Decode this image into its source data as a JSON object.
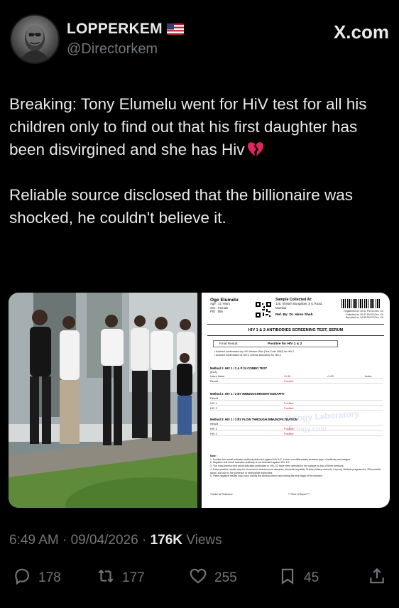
{
  "author": {
    "display_name": "LOPPERKEM",
    "handle": "@Directorkem",
    "flag_icon": "us-flag-icon"
  },
  "brand": "X.com",
  "tweet": {
    "paragraph_1": "Breaking: Tony Elumelu went for HiV test for all his children only to find out that his first daughter has been disvirgined and she has Hiv",
    "paragraph_1_emoji": "broken-heart-icon",
    "paragraph_2": "Reliable source disclosed that the billionaire was shocked, he couldn't believe it."
  },
  "report": {
    "patient_name": "Oge Elumelu",
    "age": "Age : 21 Years",
    "sex": "Sex : Female",
    "pid": "PID : 555",
    "sample_heading": "Sample Collected At:",
    "sample_address_1": "125, Shivam Bungalow, S G Road,",
    "sample_address_2": "Mumbai",
    "ref_by": "Ref. By: Dr. Hiren Shah",
    "registered_on": "Registered on: 02:31 PM 02 Dec, XX",
    "collected_on": "Collected on: 02:31 PM 02 Dec, XX",
    "reported_on": "Reported on: 04:35 PM 02 Dec, XX",
    "title": "HIV 1 & 2 ANTIBODIES SCREENING TEST, SERUM",
    "final_result_label": "Final Result:",
    "final_result_value": "Positive for HIV 1 & 2",
    "advice_1": "• Advised confirmation by HIV Western Blot (Test Code 5062) for HIV-1",
    "advice_2": "• Advised confirmation at HIV-2 referral laboratory for HIV-2",
    "method_1_title": "Method 1: HIV 1 / 2 & P 24 COMBO TEST",
    "method_1_sub": "(ELA)",
    "index_label": "Index Value",
    "index_value": "11.86",
    "index_cutoff": "<1.00",
    "index_unit": "Index",
    "result_label": "Result",
    "positive": "Positive",
    "method_2_title": "Method 2: HIV 1 / 2 BY IMMUNOCHROMATOGRAPHY",
    "method_3_title": "Method 3: HIV 1 / 2 BY FLOW THROUGH IMMUNOFILTRATION",
    "hiv1": "HIV 1",
    "hiv2": "HIV 2",
    "watermark_1": "Drlogy Laboratory",
    "watermark_2": "Drlogy.com",
    "note_heading": "Note :",
    "notes": [
      "1. Positive test result indicates antibody detected against HIV-1/2. It does not differentiate between type of antibody and antigen.",
      "2. Negative test result indicates antibody is not detected against HIV-1/2.",
      "3. The most-intrinsic test result indicates antibodies to HIV-1/2 have been detected in the sample by two of three methods.",
      "4. False-positive results may be observed in Autoimmune diseases, Alcoholic hepatitis, Primary biliary cirrhosis, Leprosy, Multiple pregnancies, Rheumatoid factor, and due to the presence of heterophile antibodies.",
      "5. False-negative results may occur during the window period and during the end stage of the disease."
    ],
    "thanks": "Thanks for Reference",
    "end_of_report": "****End of Report****"
  },
  "meta": {
    "time": "6:49 AM",
    "separator": " · ",
    "date": "09/04/2026",
    "views_count": "176K",
    "views_label": "Views"
  },
  "actions": {
    "replies": "178",
    "reposts": "177",
    "likes": "255",
    "bookmarks": "45"
  },
  "colors": {
    "background": "#000000",
    "text": "#e7e9ea",
    "secondary": "#71767b",
    "positive_red": "#c0261f"
  }
}
